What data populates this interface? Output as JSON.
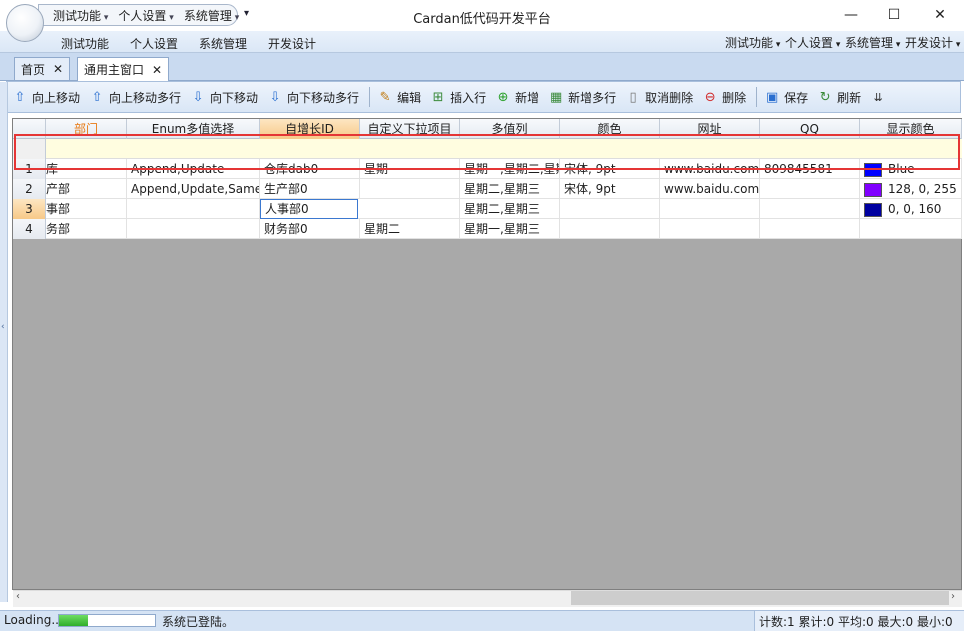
{
  "app": {
    "title": "Cardan低代码开发平台"
  },
  "quick_access": [
    "测试功能",
    "个人设置",
    "系统管理"
  ],
  "ribbon_left": [
    "测试功能",
    "个人设置",
    "系统管理",
    "开发设计"
  ],
  "ribbon_right": [
    "测试功能",
    "个人设置",
    "系统管理",
    "开发设计"
  ],
  "doc_tabs": [
    {
      "label": "首页",
      "close": "✕"
    },
    {
      "label": "通用主窗口",
      "close": "✕"
    }
  ],
  "toolbar": {
    "buttons": [
      {
        "label": "向上移动",
        "icon": "arrow-up-icon"
      },
      {
        "label": "向上移动多行",
        "icon": "arrow-up-icon"
      },
      {
        "label": "向下移动",
        "icon": "arrow-down-icon"
      },
      {
        "label": "向下移动多行",
        "icon": "arrow-down-icon"
      },
      {
        "label": "编辑",
        "icon": "edit-icon"
      },
      {
        "label": "插入行",
        "icon": "insert-row-icon"
      },
      {
        "label": "新增",
        "icon": "add-icon"
      },
      {
        "label": "新增多行",
        "icon": "add-rows-icon"
      },
      {
        "label": "取消删除",
        "icon": "undo-delete-icon"
      },
      {
        "label": "删除",
        "icon": "delete-icon"
      },
      {
        "label": "保存",
        "icon": "save-icon"
      },
      {
        "label": "刷新",
        "icon": "refresh-icon"
      }
    ]
  },
  "grid": {
    "columns": [
      "部门",
      "Enum多值选择",
      "自增长ID",
      "自定义下拉项目",
      "多值列",
      "颜色",
      "网址",
      "QQ",
      "显示颜色"
    ],
    "rows": [
      {
        "num": "1",
        "cells": [
          "库",
          "Append,Update",
          "仓库dab0",
          "星期一",
          "星期一,星期二,星期",
          "宋体, 9pt",
          "www.baidu.com",
          "809845581",
          "Blue"
        ],
        "swatch": "#0000ff"
      },
      {
        "num": "2",
        "cells": [
          "产部",
          "Append,Update,Same",
          "生产部0",
          "",
          "星期二,星期三",
          "宋体, 9pt",
          "www.baidu.com",
          "",
          "128, 0, 255"
        ],
        "swatch": "#8000ff"
      },
      {
        "num": "3",
        "cells": [
          "事部",
          "",
          "人事部0",
          "",
          "星期二,星期三",
          "",
          "",
          "",
          "0, 0, 160"
        ],
        "swatch": "#0000a0"
      },
      {
        "num": "4",
        "cells": [
          "务部",
          "",
          "财务部0",
          "星期二",
          "星期一,星期三",
          "",
          "",
          "",
          ""
        ],
        "swatch": ""
      }
    ]
  },
  "status": {
    "loading": "Loading...",
    "progress": 0.3,
    "message": "系统已登陆。",
    "stats": "计数:1 累计:0 平均:0 最大:0 最小:0"
  },
  "colors": {
    "accent": "#d5e3f4",
    "highlight_box": "#e53535",
    "filter_row": "#fffde0"
  }
}
